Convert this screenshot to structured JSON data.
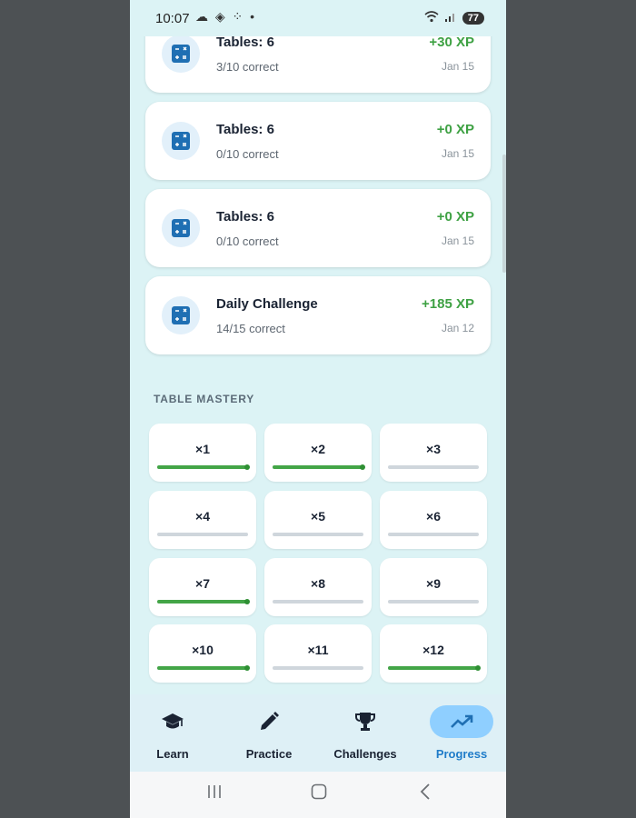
{
  "status_bar": {
    "time": "10:07",
    "notification_icons": "☁ ◈ ⁘ •",
    "battery": "77"
  },
  "activity": [
    {
      "title": "Tables: 6",
      "detail": "3/10 correct",
      "xp": "+30 XP",
      "date": "Jan 15"
    },
    {
      "title": "Tables: 6",
      "detail": "0/10 correct",
      "xp": "+0 XP",
      "date": "Jan 15"
    },
    {
      "title": "Tables: 6",
      "detail": "0/10 correct",
      "xp": "+0 XP",
      "date": "Jan 15"
    },
    {
      "title": "Daily Challenge",
      "detail": "14/15 correct",
      "xp": "+185 XP",
      "date": "Jan 12"
    }
  ],
  "table_mastery": {
    "title": "TABLE MASTERY",
    "tables": [
      {
        "label": "×1",
        "progress": 1.0
      },
      {
        "label": "×2",
        "progress": 1.0
      },
      {
        "label": "×3",
        "progress": 0
      },
      {
        "label": "×4",
        "progress": 0
      },
      {
        "label": "×5",
        "progress": 0
      },
      {
        "label": "×6",
        "progress": 0
      },
      {
        "label": "×7",
        "progress": 1.0
      },
      {
        "label": "×8",
        "progress": 0
      },
      {
        "label": "×9",
        "progress": 0
      },
      {
        "label": "×10",
        "progress": 1.0
      },
      {
        "label": "×11",
        "progress": 0
      },
      {
        "label": "×12",
        "progress": 1.0
      }
    ]
  },
  "bottom_nav": {
    "learn": "Learn",
    "practice": "Practice",
    "challenges": "Challenges",
    "progress": "Progress",
    "active": "progress"
  },
  "colors": {
    "accent": "#1f7cc9",
    "xp_green": "#3ea143",
    "background": "#dcf3f5"
  }
}
